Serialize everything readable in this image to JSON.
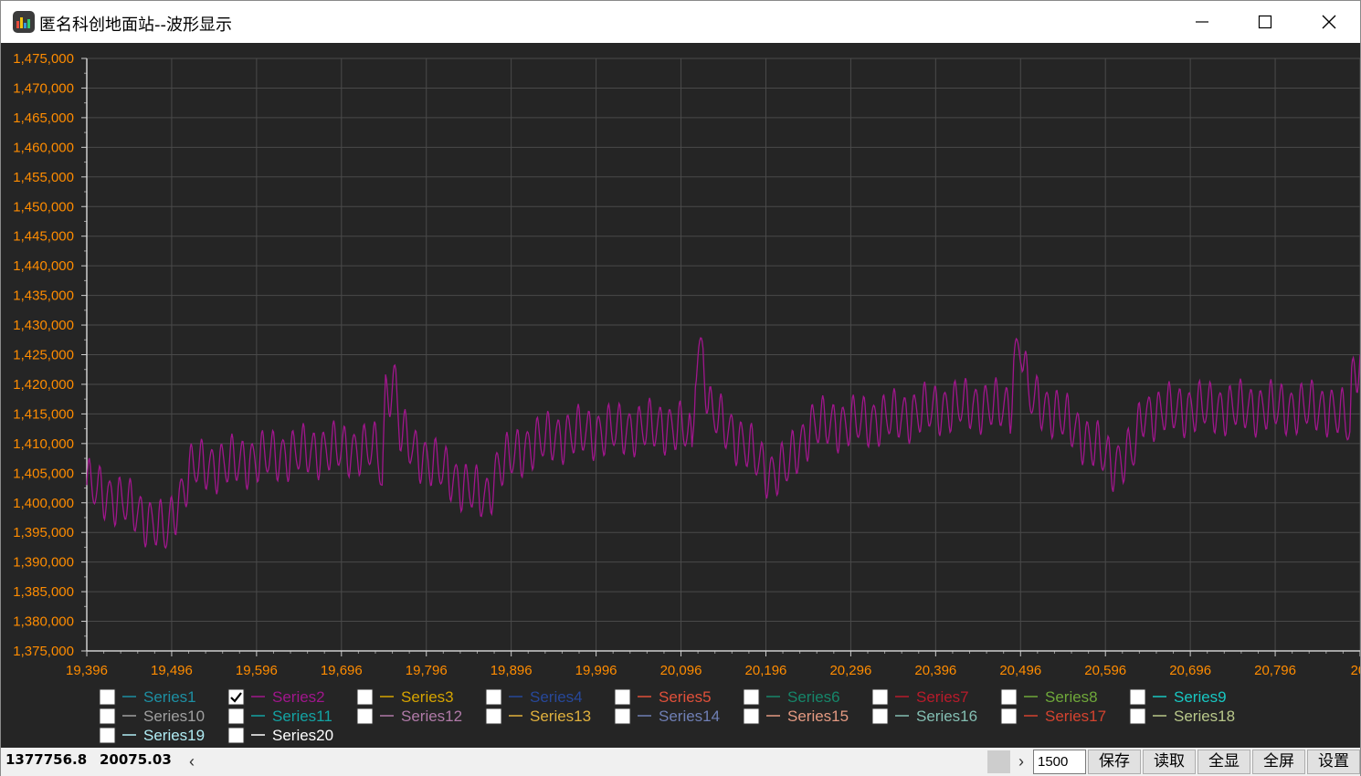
{
  "window": {
    "title": "匿名科创地面站--波形显示",
    "minimize_glyph": "—",
    "maximize_glyph": "☐",
    "close_glyph": "✕"
  },
  "icons": {
    "app": "bar-chart-icon",
    "minimize": "minimize-icon",
    "maximize": "maximize-icon",
    "close": "close-icon",
    "checkmark": "checkmark-icon",
    "scroll_left": "chevron-left-icon",
    "scroll_right": "chevron-right-icon"
  },
  "chart_data": {
    "type": "line",
    "title": "",
    "xlabel": "",
    "ylabel": "",
    "xlim": [
      19396,
      20896
    ],
    "ylim": [
      1375000,
      1475000
    ],
    "x_ticks": [
      "19,396",
      "19,496",
      "19,596",
      "19,696",
      "19,796",
      "19,896",
      "19,996",
      "20,096",
      "20,196",
      "20,296",
      "20,396",
      "20,496",
      "20,596",
      "20,696",
      "20,796",
      "20,"
    ],
    "y_ticks": [
      "1,475,000",
      "1,470,000",
      "1,465,000",
      "1,460,000",
      "1,455,000",
      "1,450,000",
      "1,445,000",
      "1,440,000",
      "1,435,000",
      "1,430,000",
      "1,425,000",
      "1,420,000",
      "1,415,000",
      "1,410,000",
      "1,405,000",
      "1,400,000",
      "1,395,000",
      "1,390,000",
      "1,385,000",
      "1,380,000",
      "1,375,000"
    ],
    "grid": true,
    "background": "#252525",
    "tick_color": "#ff8c00",
    "grid_color": "#4a4a4a",
    "series": [
      {
        "name": "Series2",
        "color": "#a0168c",
        "oscillation_amplitude": 5000,
        "oscillation_period": 12,
        "baseline": [
          [
            19396,
            1403000
          ],
          [
            19440,
            1400000
          ],
          [
            19490,
            1395000
          ],
          [
            19500,
            1399000
          ],
          [
            19520,
            1406000
          ],
          [
            19560,
            1406500
          ],
          [
            19620,
            1408000
          ],
          [
            19680,
            1409000
          ],
          [
            19740,
            1409000
          ],
          [
            19744,
            1403000
          ],
          [
            19748,
            1419000
          ],
          [
            19760,
            1420000
          ],
          [
            19765,
            1412000
          ],
          [
            19780,
            1409000
          ],
          [
            19830,
            1404000
          ],
          [
            19860,
            1401000
          ],
          [
            19868,
            1401000
          ],
          [
            19880,
            1406000
          ],
          [
            19920,
            1410000
          ],
          [
            19960,
            1411500
          ],
          [
            20000,
            1412000
          ],
          [
            20040,
            1412500
          ],
          [
            20080,
            1413000
          ],
          [
            20106,
            1412000
          ],
          [
            20109,
            1407000
          ],
          [
            20113,
            1424000
          ],
          [
            20122,
            1426000
          ],
          [
            20128,
            1416000
          ],
          [
            20140,
            1414000
          ],
          [
            20170,
            1410000
          ],
          [
            20200,
            1405000
          ],
          [
            20220,
            1406000
          ],
          [
            20250,
            1413000
          ],
          [
            20300,
            1413500
          ],
          [
            20350,
            1414500
          ],
          [
            20400,
            1416000
          ],
          [
            20440,
            1416500
          ],
          [
            20480,
            1416000
          ],
          [
            20484,
            1416000
          ],
          [
            20488,
            1424000
          ],
          [
            20497,
            1427000
          ],
          [
            20505,
            1418000
          ],
          [
            20540,
            1415000
          ],
          [
            20580,
            1410000
          ],
          [
            20605,
            1406500
          ],
          [
            20630,
            1409000
          ],
          [
            20640,
            1415000
          ],
          [
            20700,
            1416000
          ],
          [
            20780,
            1416000
          ],
          [
            20860,
            1416000
          ],
          [
            20880,
            1414000
          ],
          [
            20884,
            1412000
          ],
          [
            20886,
            1420000
          ],
          [
            20896,
            1425000
          ]
        ]
      }
    ]
  },
  "legend": {
    "items": [
      {
        "name": "Series1",
        "color": "#1d8fa3",
        "checked": false
      },
      {
        "name": "Series2",
        "color": "#a0168c",
        "checked": true
      },
      {
        "name": "Series3",
        "color": "#d6a400",
        "checked": false
      },
      {
        "name": "Series4",
        "color": "#27489a",
        "checked": false
      },
      {
        "name": "Series5",
        "color": "#e0503a",
        "checked": false
      },
      {
        "name": "Series6",
        "color": "#16866a",
        "checked": false
      },
      {
        "name": "Series7",
        "color": "#b81b2b",
        "checked": false
      },
      {
        "name": "Series8",
        "color": "#6fa83a",
        "checked": false
      },
      {
        "name": "Series9",
        "color": "#18c7c2",
        "checked": false
      },
      {
        "name": "Series10",
        "color": "#a0a0a0",
        "checked": false
      },
      {
        "name": "Series11",
        "color": "#13a3a3",
        "checked": false
      },
      {
        "name": "Series12",
        "color": "#b07aa8",
        "checked": false
      },
      {
        "name": "Series13",
        "color": "#e1b13d",
        "checked": false
      },
      {
        "name": "Series14",
        "color": "#6f7fb5",
        "checked": false
      },
      {
        "name": "Series15",
        "color": "#e59a82",
        "checked": false
      },
      {
        "name": "Series16",
        "color": "#84bfb3",
        "checked": false
      },
      {
        "name": "Series17",
        "color": "#d4432f",
        "checked": false
      },
      {
        "name": "Series18",
        "color": "#b9c88a",
        "checked": false
      },
      {
        "name": "Series19",
        "color": "#b0ecf4",
        "checked": false
      },
      {
        "name": "Series20",
        "color": "#ffffff",
        "checked": false
      }
    ]
  },
  "status": {
    "y_readout": "1377756.8",
    "x_readout": "20075.03",
    "scroll_left_glyph": "‹",
    "scroll_right_glyph": "›",
    "points_value": "1500",
    "buttons": {
      "save": "保存",
      "load": "读取",
      "show_all": "全显",
      "fullscreen": "全屏",
      "settings": "设置"
    }
  }
}
